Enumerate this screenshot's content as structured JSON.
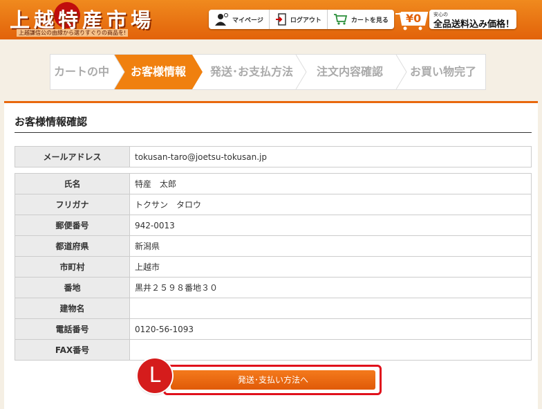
{
  "header": {
    "logo_title": "上越特産市場",
    "logo_sub": "上越謙信公の由縁から選りすぐりの商品を!",
    "nav": {
      "mypage": "マイページ",
      "logout": "ログアウト",
      "cart": "カートを見る"
    },
    "cart_total": "¥0",
    "shipping_small": "安心の",
    "shipping_main": "全品送料込み価格！"
  },
  "steps": [
    {
      "label": "カートの中",
      "active": false
    },
    {
      "label": "お客様情報",
      "active": true
    },
    {
      "label": "発送･お支払方法",
      "active": false
    },
    {
      "label": "注文内容確認",
      "active": false
    },
    {
      "label": "お買い物完了",
      "active": false
    }
  ],
  "content": {
    "title": "お客様情報確認",
    "email_row": {
      "label": "メールアドレス",
      "value": "tokusan-taro@joetsu-tokusan.jp"
    },
    "rows": [
      {
        "label": "氏名",
        "value": "特産　太郎"
      },
      {
        "label": "フリガナ",
        "value": "トクサン　タロウ"
      },
      {
        "label": "郵便番号",
        "value": "942-0013"
      },
      {
        "label": "都道府県",
        "value": "新潟県"
      },
      {
        "label": "市町村",
        "value": "上越市"
      },
      {
        "label": "番地",
        "value": "黒井２５９８番地３０"
      },
      {
        "label": "建物名",
        "value": ""
      },
      {
        "label": "電話番号",
        "value": "0120-56-1093"
      },
      {
        "label": "FAX番号",
        "value": ""
      }
    ],
    "next_button": "発送･支払い方法へ",
    "marker": "L"
  },
  "colors": {
    "brand_orange": "#e8680d",
    "marker_red": "#d51c1c",
    "highlight_red": "#e0101c"
  }
}
